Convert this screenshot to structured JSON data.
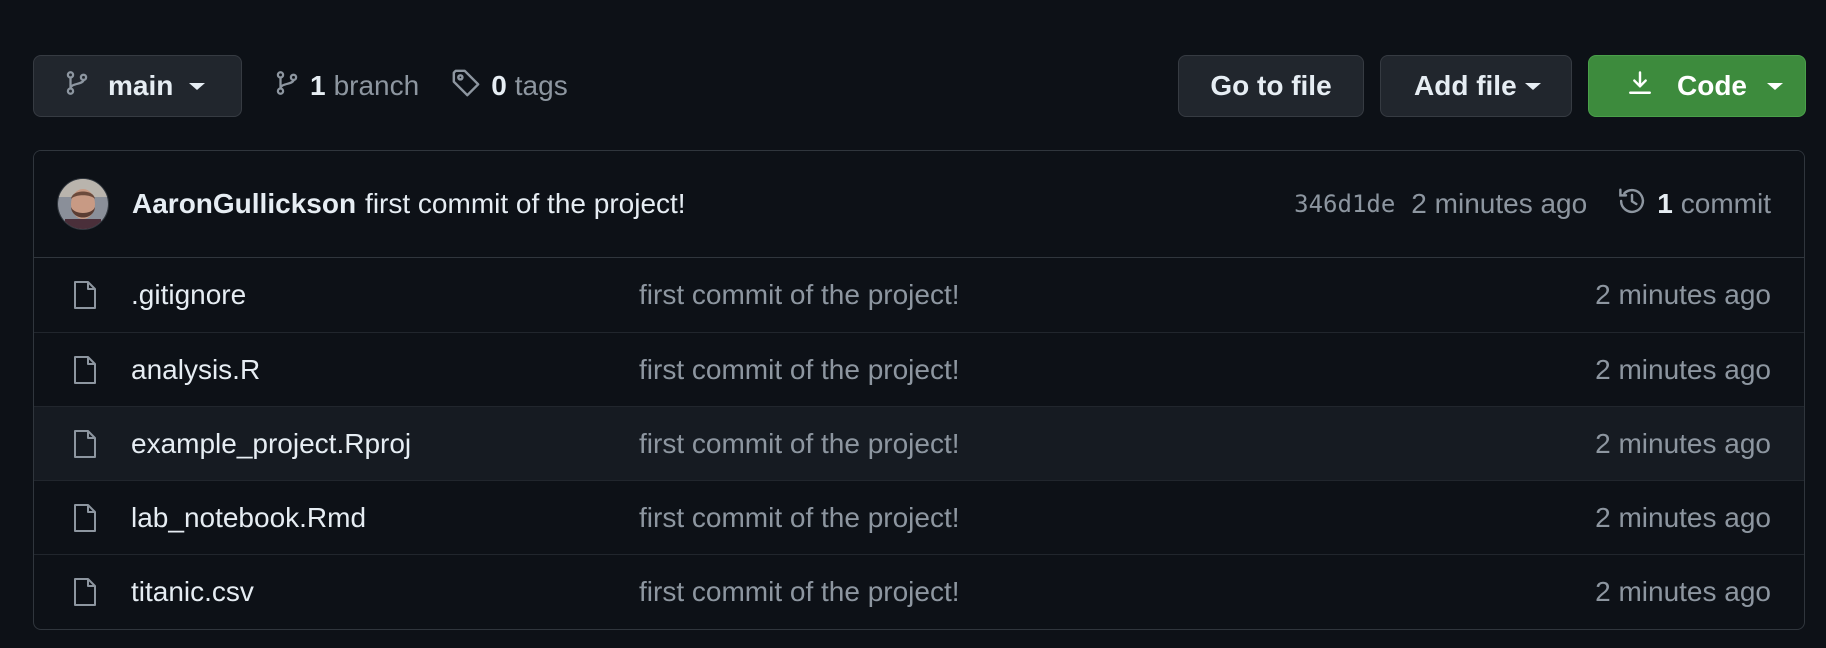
{
  "toolbar": {
    "branch_name": "main",
    "branches_count": "1",
    "branches_label": "branch",
    "tags_count": "0",
    "tags_label": "tags",
    "goto_file_label": "Go to file",
    "add_file_label": "Add file",
    "code_label": "Code",
    "code_button_color": "#3d8b3d"
  },
  "latest_commit": {
    "author": "AaronGullickson",
    "message": "first commit of the project!",
    "sha": "346d1de",
    "time": "2 minutes ago",
    "commit_count": "1",
    "commit_label": "commit"
  },
  "files": [
    {
      "name": ".gitignore",
      "commit": "first commit of the project!",
      "time": "2 minutes ago",
      "icon": "file-icon"
    },
    {
      "name": "analysis.R",
      "commit": "first commit of the project!",
      "time": "2 minutes ago",
      "icon": "file-icon"
    },
    {
      "name": "example_project.Rproj",
      "commit": "first commit of the project!",
      "time": "2 minutes ago",
      "icon": "file-icon"
    },
    {
      "name": "lab_notebook.Rmd",
      "commit": "first commit of the project!",
      "time": "2 minutes ago",
      "icon": "file-icon"
    },
    {
      "name": "titanic.csv",
      "commit": "first commit of the project!",
      "time": "2 minutes ago",
      "icon": "file-icon"
    }
  ]
}
